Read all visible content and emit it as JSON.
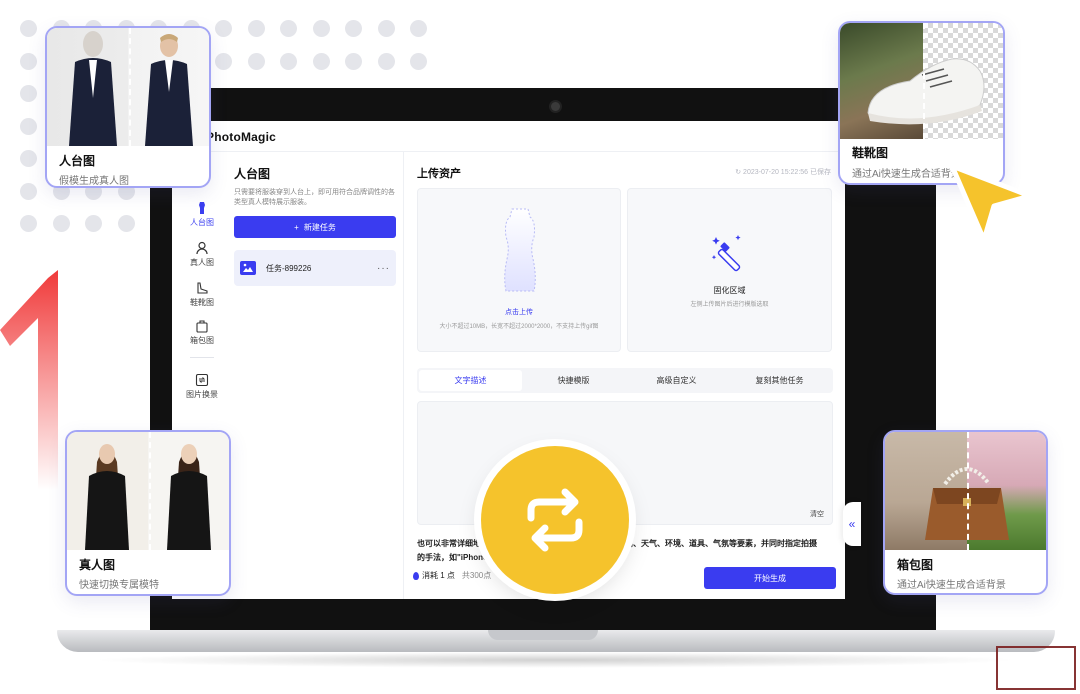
{
  "app": {
    "title": "PhotoMagic"
  },
  "nav": [
    {
      "label": "人台图",
      "icon": "mannequin-icon",
      "active": true
    },
    {
      "label": "真人图",
      "icon": "person-icon"
    },
    {
      "label": "鞋靴图",
      "icon": "shoe-icon"
    },
    {
      "label": "箱包图",
      "icon": "bag-icon"
    },
    {
      "label": "图片换景",
      "icon": "image-swap-icon"
    }
  ],
  "left_panel": {
    "title": "人台图",
    "desc": "只需要将服装穿到人台上，即可用符合品牌调性的各类型真人模特展示服装。",
    "new_task_label": "新建任务",
    "task_label": "任务-899226",
    "task_more": "···"
  },
  "main": {
    "title": "上传资产",
    "timestamp": "2023-07-20 15:22:56 已保存",
    "upload": {
      "link": "点击上传",
      "hint": "大小不超过10MB，长宽不超过2000*2000，不支持上传gif图"
    },
    "fix": {
      "title": "固化区域",
      "hint": "左侧上传图片后进行模版选取"
    },
    "tabs": [
      "文字描述",
      "快捷模版",
      "高级自定义",
      "复刻其他任务"
    ],
    "active_tab": 0,
    "clear_label": "清空",
    "desc_line1": "也可以非常详细地",
    "desc_line1b": "间、天气、环境、道具、气氛等要素，并同时指定拍摄",
    "desc_line2": "的手法，如\"iPhone",
    "cost_label": "消耗 1 点",
    "cost_total": "共300点",
    "start_label": "开始生成",
    "collapse_label": "«"
  },
  "cards": {
    "mannequin": {
      "title": "人台图",
      "subtitle": "假模生成真人图"
    },
    "shoes": {
      "title": "鞋靴图",
      "subtitle": "通过Ai快速生成合适背景"
    },
    "person": {
      "title": "真人图",
      "subtitle": "快速切换专属模特"
    },
    "bag": {
      "title": "箱包图",
      "subtitle": "通过Ai快速生成合适背景"
    }
  },
  "colors": {
    "accent": "#3a3cf0",
    "card_border": "#a3a5f5",
    "swap_badge": "#f5c32c",
    "cursor": "#f5c32c",
    "red_arrow": "#f03a3a"
  }
}
